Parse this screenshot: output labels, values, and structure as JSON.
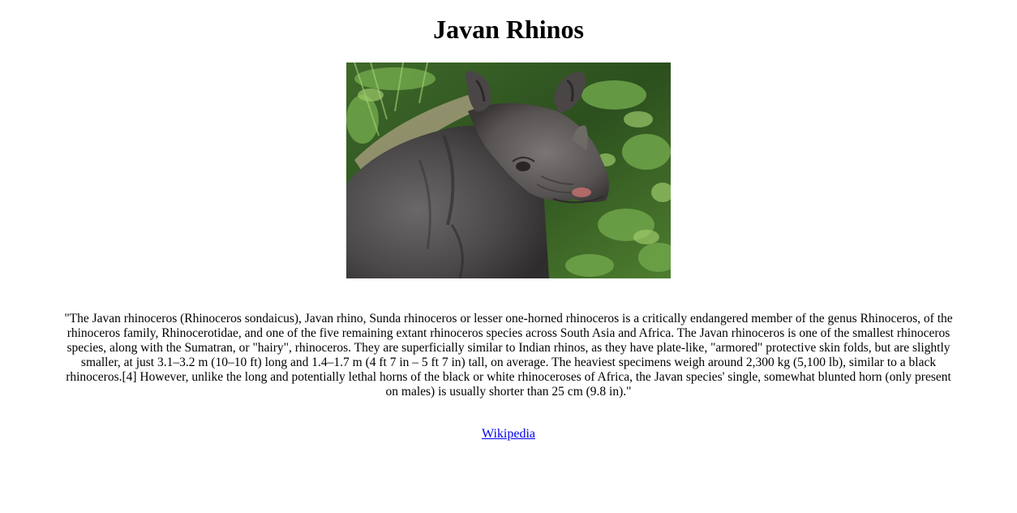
{
  "page": {
    "title": "Javan Rhinos",
    "image_alt": "Javan rhinoceros standing in green foliage",
    "description": "\"The Javan rhinoceros (Rhinoceros sondaicus), Javan rhino, Sunda rhinoceros or lesser one-horned rhinoceros is a critically endangered member of the genus Rhinoceros, of the rhinoceros family, Rhinocerotidae, and one of the five remaining extant rhinoceros species across South Asia and Africa. The Javan rhinoceros is one of the smallest rhinoceros species, along with the Sumatran, or \"hairy\", rhinoceros. They are superficially similar to Indian rhinos, as they have plate-like, \"armored\" protective skin folds, but are slightly smaller, at just 3.1–3.2 m (10–10 ft) long and 1.4–1.7 m (4 ft 7 in – 5 ft 7 in) tall, on average. The heaviest specimens weigh around 2,300 kg (5,100 lb), similar to a black rhinoceros.[4] However, unlike the long and potentially lethal horns of the black or white rhinoceroses of Africa, the Javan species' single, somewhat blunted horn (only present on males) is usually shorter than 25 cm (9.8 in).\"",
    "link_label": "Wikipedia"
  },
  "colors": {
    "link": "#0000ee",
    "text": "#000000",
    "background": "#ffffff"
  }
}
